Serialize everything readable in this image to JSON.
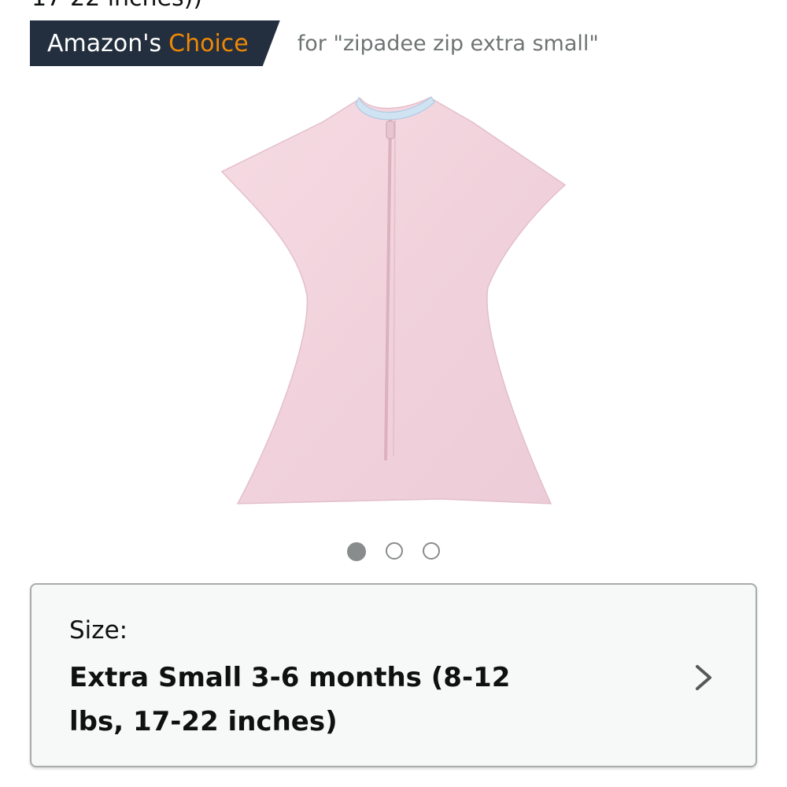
{
  "header": {
    "cutoff_text": "17-22 inches))"
  },
  "badge": {
    "prefix": "Amazon's",
    "highlight": "Choice",
    "context": "for \"zipadee zip extra small\"",
    "colors": {
      "background": "#232f3e",
      "highlight": "#f08804"
    }
  },
  "carousel": {
    "total_images": 3,
    "active_index": 0
  },
  "size_selector": {
    "label": "Size:",
    "value": "Extra Small 3-6 months (8-12 lbs, 17-22 inches)",
    "icon": "chevron-right-icon"
  }
}
